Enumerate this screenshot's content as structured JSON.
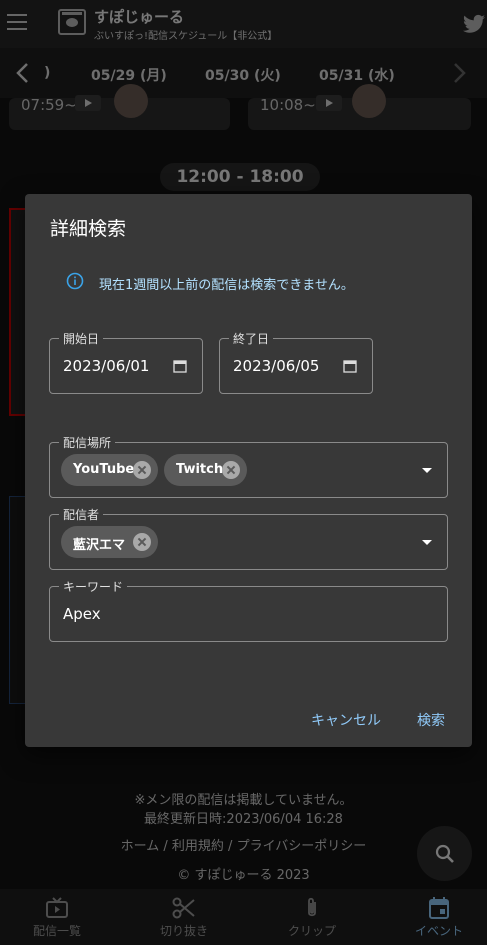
{
  "app": {
    "title": "すぽじゅーる",
    "subtitle": "ぶいすぽっ!配信スケジュール【非公式】"
  },
  "date_nav": {
    "tabs": [
      ")",
      "05/29 (月)",
      "05/30 (火)",
      "05/31 (水)"
    ]
  },
  "background": {
    "cards": [
      {
        "time": "07:59~"
      },
      {
        "time": "10:08~"
      }
    ],
    "time_range": "12:00 - 18:00"
  },
  "dialog": {
    "title": "詳細検索",
    "info": "現在1週間以上前の配信は検索できません。",
    "start_date": {
      "label": "開始日",
      "value": "2023/06/01"
    },
    "end_date": {
      "label": "終了日",
      "value": "2023/06/05"
    },
    "platform": {
      "label": "配信場所",
      "chips": [
        "YouTube",
        "Twitch"
      ]
    },
    "streamer": {
      "label": "配信者",
      "chips": [
        "藍沢エマ"
      ]
    },
    "keyword": {
      "label": "キーワード",
      "value": "Apex"
    },
    "cancel_label": "キャンセル",
    "search_label": "検索"
  },
  "footer": {
    "note": "※メン限の配信は掲載していません。",
    "updated": "最終更新日時:2023/06/04 16:28",
    "links": "ホーム / 利用規約 / プライバシーポリシー",
    "copyright": "© すぽじゅーる 2023"
  },
  "bottom_nav": {
    "items": [
      {
        "label": "配信一覧",
        "icon": "tv-icon"
      },
      {
        "label": "切り抜き",
        "icon": "scissors-icon"
      },
      {
        "label": "クリップ",
        "icon": "paperclip-icon"
      },
      {
        "label": "イベント",
        "icon": "calendar-icon"
      }
    ],
    "active": "イベント"
  },
  "colors": {
    "accent": "#90caf9",
    "info_text": "#b3e1ff",
    "dialog_bg": "#383838",
    "chip_bg": "#5a5a5a"
  }
}
